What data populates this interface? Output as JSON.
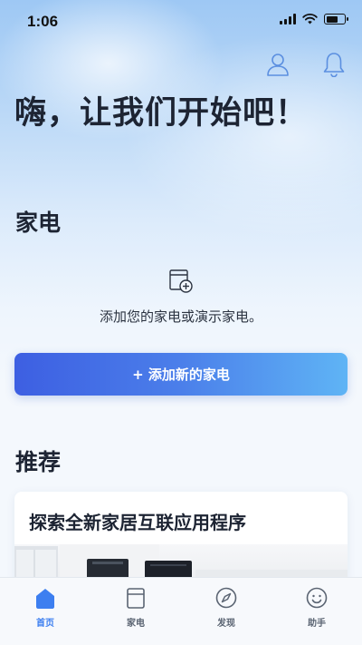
{
  "status_bar": {
    "time": "1:06",
    "battery_level": 0.7
  },
  "header": {
    "greeting": "嗨，让我们开始吧！",
    "icons": [
      "user-icon",
      "bell-icon"
    ]
  },
  "appliances": {
    "title": "家电",
    "empty_text": "添加您的家电或演示家电。",
    "add_button_label": "+ 添加新的家电"
  },
  "recommended": {
    "title": "推荐",
    "card_title": "探索全新家居互联应用程序"
  },
  "tabbar": {
    "accent_color": "#3d7ff0",
    "tabs": [
      {
        "label": "首页",
        "icon": "home-icon",
        "active": true
      },
      {
        "label": "家电",
        "icon": "appliance-icon",
        "active": false
      },
      {
        "label": "发现",
        "icon": "compass-icon",
        "active": false
      },
      {
        "label": "助手",
        "icon": "smile-icon",
        "active": false
      }
    ]
  }
}
